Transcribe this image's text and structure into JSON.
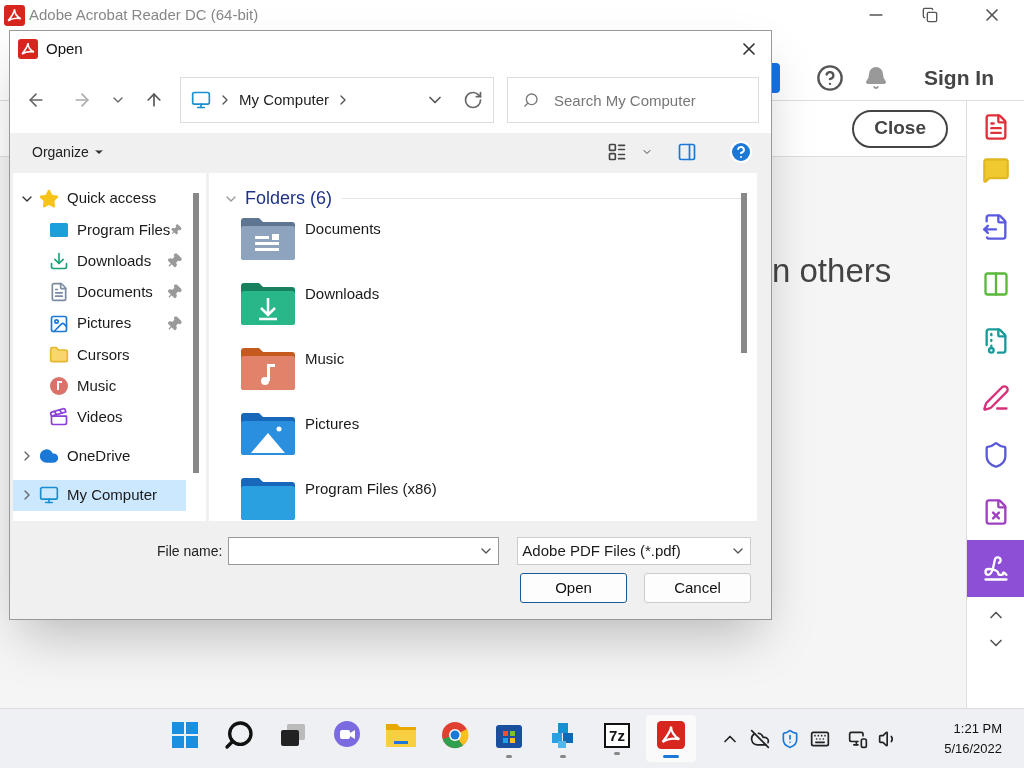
{
  "acrobat": {
    "title": "Adobe Acrobat Reader DC (64-bit)",
    "sign_in": "Sign In",
    "close_button": "Close",
    "body_text": "n others",
    "tools": [
      {
        "kind": "create",
        "selected": false
      },
      {
        "kind": "comment",
        "selected": false
      },
      {
        "kind": "export",
        "selected": false
      },
      {
        "kind": "organize",
        "selected": false
      },
      {
        "kind": "compress",
        "selected": false
      },
      {
        "kind": "fill",
        "selected": false
      },
      {
        "kind": "protect",
        "selected": false
      },
      {
        "kind": "form",
        "selected": false
      },
      {
        "kind": "sign",
        "selected": true
      }
    ]
  },
  "dialog": {
    "title": "Open",
    "address": "My Computer",
    "search": {
      "placeholder": "Search My Computer"
    },
    "organize": "Organize",
    "nav": [
      {
        "kind": "star",
        "label": "Quick access",
        "expanded": true,
        "selected": false,
        "children": [
          {
            "kind": "programs",
            "label": "Program Files",
            "pinned": true,
            "selected": false
          },
          {
            "kind": "downloads",
            "label": "Downloads",
            "pinned": true,
            "selected": false
          },
          {
            "kind": "documents",
            "label": "Documents",
            "pinned": true,
            "selected": false
          },
          {
            "kind": "pictures",
            "label": "Pictures",
            "pinned": true,
            "selected": false
          },
          {
            "kind": "folder",
            "label": "Cursors",
            "pinned": false,
            "selected": false
          },
          {
            "kind": "music",
            "label": "Music",
            "pinned": false,
            "selected": false
          },
          {
            "kind": "videos",
            "label": "Videos",
            "pinned": false,
            "selected": false
          }
        ]
      },
      {
        "kind": "cloud",
        "label": "OneDrive",
        "expanded": false,
        "selected": false
      },
      {
        "kind": "computer",
        "label": "My Computer",
        "expanded": false,
        "selected": true
      }
    ],
    "group": {
      "label": "Folders (6)",
      "expanded": true
    },
    "folders": [
      {
        "kind": "documents",
        "label": "Documents"
      },
      {
        "kind": "downloads",
        "label": "Downloads"
      },
      {
        "kind": "music",
        "label": "Music"
      },
      {
        "kind": "pictures",
        "label": "Pictures"
      },
      {
        "kind": "programs",
        "label": "Program Files (x86)"
      }
    ],
    "file_name_label": "File name:",
    "file_type": "Adobe PDF Files (*.pdf)",
    "buttons": [
      "Open",
      "Cancel"
    ]
  },
  "taskbar": {
    "apps": [
      {
        "kind": "start",
        "running": false,
        "active": false
      },
      {
        "kind": "search",
        "running": false,
        "active": false
      },
      {
        "kind": "taskview",
        "running": false,
        "active": false
      },
      {
        "kind": "chat",
        "running": false,
        "active": false
      },
      {
        "kind": "explorer",
        "running": false,
        "active": false
      },
      {
        "kind": "chrome",
        "running": false,
        "active": false
      },
      {
        "kind": "store",
        "running": true,
        "active": false
      },
      {
        "kind": "cube",
        "running": true,
        "active": false
      },
      {
        "kind": "archiver",
        "label": "7z",
        "running": true,
        "active": false
      },
      {
        "kind": "acrobat",
        "running": true,
        "active": true
      }
    ],
    "time": "1:21 PM",
    "date": "5/16/2022"
  }
}
